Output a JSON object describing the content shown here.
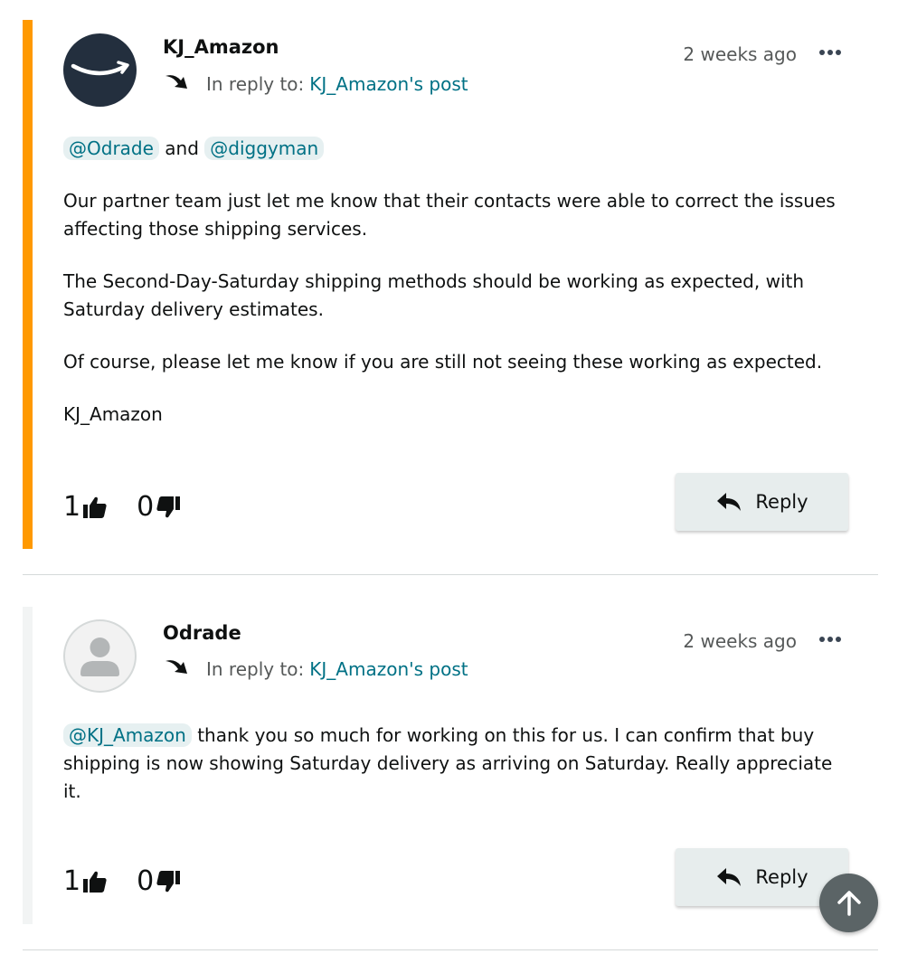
{
  "posts": [
    {
      "author": "KJ_Amazon",
      "reply_prefix": "In reply to:",
      "reply_link": "KJ_Amazon's post",
      "timestamp": "2 weeks ago",
      "mention_1": "@Odrade",
      "mention_and": "and",
      "mention_2": "@diggyman",
      "paragraph_1": "Our partner team just let me know that their contacts were able to correct the issues affecting those shipping services.",
      "paragraph_2": "The Second-Day-Saturday shipping methods should be working as expected, with Saturday delivery estimates.",
      "paragraph_3": "Of course, please let me know if you are still not seeing these working as expected.",
      "signature": "KJ_Amazon",
      "likes": "1",
      "dislikes": "0",
      "reply_label": "Reply",
      "accent_color": "#ff9900"
    },
    {
      "author": "Odrade",
      "reply_prefix": "In reply to:",
      "reply_link": "KJ_Amazon's post",
      "timestamp": "2 weeks ago",
      "mention_1": "@KJ_Amazon",
      "body_text": "thank you so much for working on this for us. I can confirm that buy shipping is now showing Saturday delivery as arriving on Saturday. Really appreciate it.",
      "likes": "1",
      "dislikes": "0",
      "reply_label": "Reply"
    }
  ],
  "colors": {
    "link": "#007185",
    "amazon_avatar_bg": "#232f3e",
    "reply_button_bg": "#e7eded",
    "scroll_top_bg": "#5b6466"
  },
  "icons": {
    "amazon_logo": "amazon-smile-logo-icon",
    "default_avatar": "user-silhouette-icon",
    "reply_arrow": "curved-arrow-icon",
    "more": "ellipsis-icon",
    "like": "thumbs-up-icon",
    "dislike": "thumbs-down-icon",
    "reply": "reply-arrow-icon",
    "scroll_top": "arrow-up-icon"
  }
}
